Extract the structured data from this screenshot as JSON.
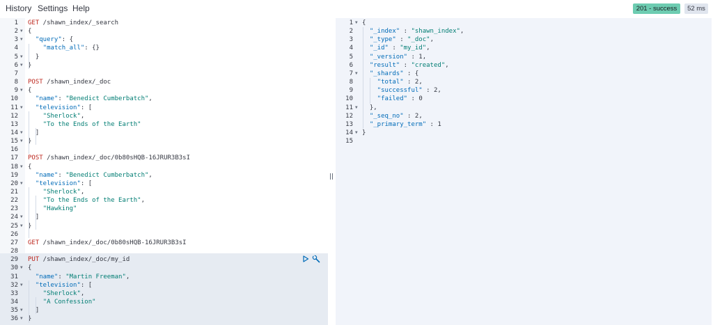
{
  "menu": {
    "history": "History",
    "settings": "Settings",
    "help": "Help"
  },
  "status": {
    "label": "201 - success",
    "time": "52 ms",
    "success_color": "#6dccb1"
  },
  "request_editor": {
    "lines": [
      {
        "n": "1",
        "fold": false,
        "text": [
          [
            "method",
            "GET"
          ],
          [
            "path",
            " /shawn_index/_search"
          ]
        ]
      },
      {
        "n": "2",
        "fold": true,
        "text": [
          [
            "p",
            "{"
          ]
        ]
      },
      {
        "n": "3",
        "fold": true,
        "text": [
          [
            "p",
            "  "
          ],
          [
            "key",
            "\"query\""
          ],
          [
            "p",
            ": {"
          ]
        ]
      },
      {
        "n": "4",
        "fold": false,
        "text": [
          [
            "p",
            "    "
          ],
          [
            "key",
            "\"match_all\""
          ],
          [
            "p",
            ": {}"
          ]
        ]
      },
      {
        "n": "5",
        "fold": true,
        "text": [
          [
            "p",
            "  }"
          ]
        ]
      },
      {
        "n": "6",
        "fold": true,
        "text": [
          [
            "p",
            "}"
          ]
        ]
      },
      {
        "n": "7",
        "fold": false,
        "text": []
      },
      {
        "n": "8",
        "fold": false,
        "text": [
          [
            "method",
            "POST"
          ],
          [
            "path",
            " /shawn_index/_doc"
          ]
        ]
      },
      {
        "n": "9",
        "fold": true,
        "text": [
          [
            "p",
            "{"
          ]
        ]
      },
      {
        "n": "10",
        "fold": false,
        "text": [
          [
            "p",
            "  "
          ],
          [
            "key",
            "\"name\""
          ],
          [
            "p",
            ": "
          ],
          [
            "str",
            "\"Benedict Cumberbatch\""
          ],
          [
            "p",
            ","
          ]
        ]
      },
      {
        "n": "11",
        "fold": true,
        "text": [
          [
            "p",
            "  "
          ],
          [
            "key",
            "\"television\""
          ],
          [
            "p",
            ": ["
          ]
        ]
      },
      {
        "n": "12",
        "fold": false,
        "text": [
          [
            "p",
            "    "
          ],
          [
            "str",
            "\"Sherlock\""
          ],
          [
            "p",
            ","
          ]
        ]
      },
      {
        "n": "13",
        "fold": false,
        "text": [
          [
            "p",
            "    "
          ],
          [
            "str",
            "\"To the Ends of the Earth\""
          ]
        ]
      },
      {
        "n": "14",
        "fold": true,
        "text": [
          [
            "p",
            "  ]"
          ]
        ]
      },
      {
        "n": "15",
        "fold": true,
        "text": [
          [
            "p",
            "}"
          ]
        ]
      },
      {
        "n": "16",
        "fold": false,
        "text": []
      },
      {
        "n": "17",
        "fold": false,
        "text": [
          [
            "method",
            "POST"
          ],
          [
            "path",
            " /shawn_index/_doc/0b80sHQB-16JRUR3B3sI"
          ]
        ]
      },
      {
        "n": "18",
        "fold": true,
        "text": [
          [
            "p",
            "{"
          ]
        ]
      },
      {
        "n": "19",
        "fold": false,
        "text": [
          [
            "p",
            "  "
          ],
          [
            "key",
            "\"name\""
          ],
          [
            "p",
            ": "
          ],
          [
            "str",
            "\"Benedict Cumberbatch\""
          ],
          [
            "p",
            ","
          ]
        ]
      },
      {
        "n": "20",
        "fold": true,
        "text": [
          [
            "p",
            "  "
          ],
          [
            "key",
            "\"television\""
          ],
          [
            "p",
            ": ["
          ]
        ]
      },
      {
        "n": "21",
        "fold": false,
        "text": [
          [
            "p",
            "    "
          ],
          [
            "str",
            "\"Sherlock\""
          ],
          [
            "p",
            ","
          ]
        ]
      },
      {
        "n": "22",
        "fold": false,
        "text": [
          [
            "p",
            "    "
          ],
          [
            "str",
            "\"To the Ends of the Earth\""
          ],
          [
            "p",
            ","
          ]
        ]
      },
      {
        "n": "23",
        "fold": false,
        "text": [
          [
            "p",
            "    "
          ],
          [
            "str",
            "\"Hawking\""
          ]
        ]
      },
      {
        "n": "24",
        "fold": true,
        "text": [
          [
            "p",
            "  ]"
          ]
        ]
      },
      {
        "n": "25",
        "fold": true,
        "text": [
          [
            "p",
            "}"
          ]
        ]
      },
      {
        "n": "26",
        "fold": false,
        "text": []
      },
      {
        "n": "27",
        "fold": false,
        "text": [
          [
            "method",
            "GET"
          ],
          [
            "path",
            " /shawn_index/_doc/0b80sHQB-16JRUR3B3sI"
          ]
        ]
      },
      {
        "n": "28",
        "fold": false,
        "text": []
      },
      {
        "n": "29",
        "fold": false,
        "text": [
          [
            "method",
            "PUT"
          ],
          [
            "path",
            " /shawn_index/_doc/my_id"
          ]
        ]
      },
      {
        "n": "30",
        "fold": true,
        "text": [
          [
            "p",
            "{"
          ]
        ]
      },
      {
        "n": "31",
        "fold": false,
        "text": [
          [
            "p",
            "  "
          ],
          [
            "key",
            "\"name\""
          ],
          [
            "p",
            ": "
          ],
          [
            "str",
            "\"Martin Freeman\""
          ],
          [
            "p",
            ","
          ]
        ]
      },
      {
        "n": "32",
        "fold": true,
        "text": [
          [
            "p",
            "  "
          ],
          [
            "key",
            "\"television\""
          ],
          [
            "p",
            ": ["
          ]
        ]
      },
      {
        "n": "33",
        "fold": false,
        "text": [
          [
            "p",
            "    "
          ],
          [
            "str",
            "\"Sherlock\""
          ],
          [
            "p",
            ","
          ]
        ]
      },
      {
        "n": "34",
        "fold": false,
        "text": [
          [
            "p",
            "    "
          ],
          [
            "str",
            "\"A Confession\""
          ]
        ]
      },
      {
        "n": "35",
        "fold": true,
        "text": [
          [
            "p",
            "  ]"
          ]
        ]
      },
      {
        "n": "36",
        "fold": true,
        "text": [
          [
            "p",
            "}"
          ]
        ]
      }
    ]
  },
  "response_editor": {
    "lines": [
      {
        "n": "1",
        "fold": true,
        "text": [
          [
            "p",
            "{"
          ]
        ]
      },
      {
        "n": "2",
        "fold": false,
        "text": [
          [
            "p",
            "  "
          ],
          [
            "key",
            "\"_index\""
          ],
          [
            "p",
            " : "
          ],
          [
            "str",
            "\"shawn_index\""
          ],
          [
            "p",
            ","
          ]
        ]
      },
      {
        "n": "3",
        "fold": false,
        "text": [
          [
            "p",
            "  "
          ],
          [
            "key",
            "\"_type\""
          ],
          [
            "p",
            " : "
          ],
          [
            "str",
            "\"_doc\""
          ],
          [
            "p",
            ","
          ]
        ]
      },
      {
        "n": "4",
        "fold": false,
        "text": [
          [
            "p",
            "  "
          ],
          [
            "key",
            "\"_id\""
          ],
          [
            "p",
            " : "
          ],
          [
            "str",
            "\"my_id\""
          ],
          [
            "p",
            ","
          ]
        ]
      },
      {
        "n": "5",
        "fold": false,
        "text": [
          [
            "p",
            "  "
          ],
          [
            "key",
            "\"_version\""
          ],
          [
            "p",
            " : "
          ],
          [
            "num",
            "1"
          ],
          [
            "p",
            ","
          ]
        ]
      },
      {
        "n": "6",
        "fold": false,
        "text": [
          [
            "p",
            "  "
          ],
          [
            "key",
            "\"result\""
          ],
          [
            "p",
            " : "
          ],
          [
            "str",
            "\"created\""
          ],
          [
            "p",
            ","
          ]
        ]
      },
      {
        "n": "7",
        "fold": true,
        "text": [
          [
            "p",
            "  "
          ],
          [
            "key",
            "\"_shards\""
          ],
          [
            "p",
            " : {"
          ]
        ]
      },
      {
        "n": "8",
        "fold": false,
        "text": [
          [
            "p",
            "    "
          ],
          [
            "key",
            "\"total\""
          ],
          [
            "p",
            " : "
          ],
          [
            "num",
            "2"
          ],
          [
            "p",
            ","
          ]
        ]
      },
      {
        "n": "9",
        "fold": false,
        "text": [
          [
            "p",
            "    "
          ],
          [
            "key",
            "\"successful\""
          ],
          [
            "p",
            " : "
          ],
          [
            "num",
            "2"
          ],
          [
            "p",
            ","
          ]
        ]
      },
      {
        "n": "10",
        "fold": false,
        "text": [
          [
            "p",
            "    "
          ],
          [
            "key",
            "\"failed\""
          ],
          [
            "p",
            " : "
          ],
          [
            "num",
            "0"
          ]
        ]
      },
      {
        "n": "11",
        "fold": true,
        "text": [
          [
            "p",
            "  },"
          ]
        ]
      },
      {
        "n": "12",
        "fold": false,
        "text": [
          [
            "p",
            "  "
          ],
          [
            "key",
            "\"_seq_no\""
          ],
          [
            "p",
            " : "
          ],
          [
            "num",
            "2"
          ],
          [
            "p",
            ","
          ]
        ]
      },
      {
        "n": "13",
        "fold": false,
        "text": [
          [
            "p",
            "  "
          ],
          [
            "key",
            "\"_primary_term\""
          ],
          [
            "p",
            " : "
          ],
          [
            "num",
            "1"
          ]
        ]
      },
      {
        "n": "14",
        "fold": true,
        "text": [
          [
            "p",
            "}"
          ]
        ]
      },
      {
        "n": "15",
        "fold": false,
        "text": []
      }
    ]
  },
  "actions": {
    "run_icon": "play-icon",
    "menu_icon": "wrench-icon"
  }
}
